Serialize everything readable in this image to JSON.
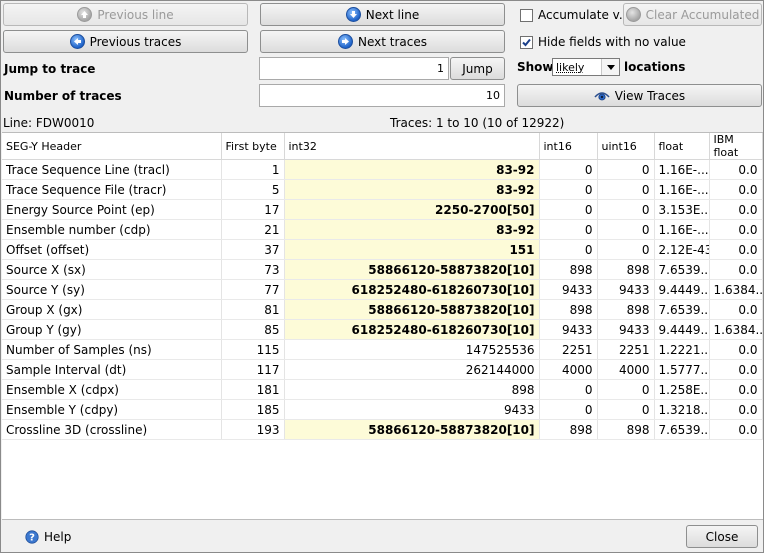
{
  "toolbar": {
    "previous_line": "Previous line",
    "next_line": "Next line",
    "previous_traces": "Previous traces",
    "next_traces": "Next traces",
    "accumulate": "Accumulate v...",
    "clear_accumulated": "Clear Accumulated",
    "hide_empty": "Hide fields with no value",
    "jump_to_trace_label": "Jump to trace",
    "jump_to_trace_value": "1",
    "jump_button": "Jump",
    "number_of_traces_label": "Number of traces",
    "number_of_traces_value": "10",
    "show_label": "Show",
    "show_selected": "likely",
    "locations_label": "locations",
    "view_traces": "View Traces"
  },
  "info": {
    "line": "Line: FDW0010",
    "traces": "Traces: 1 to 10 (10 of 12922)"
  },
  "table": {
    "headers": [
      "SEG-Y Header",
      "First byte",
      "int32",
      "int16",
      "uint16",
      "float",
      "IBM float"
    ],
    "rows": [
      {
        "name": "Trace Sequence Line (tracl)",
        "byte": "1",
        "int32": "83-92",
        "int16": "0",
        "uint16": "0",
        "float": "1.16E-...",
        "ibm": "0.0",
        "hl": true
      },
      {
        "name": "Trace Sequence File (tracr)",
        "byte": "5",
        "int32": "83-92",
        "int16": "0",
        "uint16": "0",
        "float": "1.16E-...",
        "ibm": "0.0",
        "hl": true
      },
      {
        "name": "Energy Source Point (ep)",
        "byte": "17",
        "int32": "2250-2700[50]",
        "int16": "0",
        "uint16": "0",
        "float": "3.153E...",
        "ibm": "0.0",
        "hl": true
      },
      {
        "name": "Ensemble number (cdp)",
        "byte": "21",
        "int32": "83-92",
        "int16": "0",
        "uint16": "0",
        "float": "1.16E-...",
        "ibm": "0.0",
        "hl": true
      },
      {
        "name": "Offset (offset)",
        "byte": "37",
        "int32": "151",
        "int16": "0",
        "uint16": "0",
        "float": "2.12E-43",
        "ibm": "0.0",
        "hl": true
      },
      {
        "name": "Source X (sx)",
        "byte": "73",
        "int32": "58866120-58873820[10]",
        "int16": "898",
        "uint16": "898",
        "float": "7.6539...",
        "ibm": "0.0",
        "hl": true
      },
      {
        "name": "Source Y (sy)",
        "byte": "77",
        "int32": "618252480-618260730[10]",
        "int16": "9433",
        "uint16": "9433",
        "float": "9.4449...",
        "ibm": "1.6384...",
        "hl": true
      },
      {
        "name": "Group X (gx)",
        "byte": "81",
        "int32": "58866120-58873820[10]",
        "int16": "898",
        "uint16": "898",
        "float": "7.6539...",
        "ibm": "0.0",
        "hl": true
      },
      {
        "name": "Group Y (gy)",
        "byte": "85",
        "int32": "618252480-618260730[10]",
        "int16": "9433",
        "uint16": "9433",
        "float": "9.4449...",
        "ibm": "1.6384...",
        "hl": true
      },
      {
        "name": "Number of Samples (ns)",
        "byte": "115",
        "int32": "147525536",
        "int16": "2251",
        "uint16": "2251",
        "float": "1.2221...",
        "ibm": "0.0",
        "hl": false
      },
      {
        "name": "Sample Interval (dt)",
        "byte": "117",
        "int32": "262144000",
        "int16": "4000",
        "uint16": "4000",
        "float": "1.5777...",
        "ibm": "0.0",
        "hl": false
      },
      {
        "name": "Ensemble X (cdpx)",
        "byte": "181",
        "int32": "898",
        "int16": "0",
        "uint16": "0",
        "float": "1.258E...",
        "ibm": "0.0",
        "hl": false
      },
      {
        "name": "Ensemble Y (cdpy)",
        "byte": "185",
        "int32": "9433",
        "int16": "0",
        "uint16": "0",
        "float": "1.3218...",
        "ibm": "0.0",
        "hl": false
      },
      {
        "name": "Crossline 3D (crossline)",
        "byte": "193",
        "int32": "58866120-58873820[10]",
        "int16": "898",
        "uint16": "898",
        "float": "7.6539...",
        "ibm": "0.0",
        "hl": true
      }
    ]
  },
  "footer": {
    "help": "Help",
    "close": "Close"
  }
}
